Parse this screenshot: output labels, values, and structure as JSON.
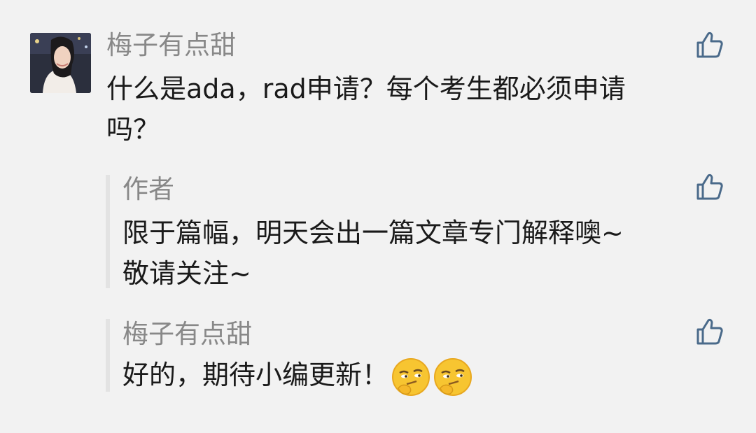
{
  "comment": {
    "author": "梅子有点甜",
    "text_line1": "什么是ada，rad申请？每个考生都必须申请",
    "text_line2": "吗？",
    "like_icon": "thumbs-up-outline-icon"
  },
  "replies": [
    {
      "author": "作者",
      "text_line1": "限于篇幅，明天会出一篇文章专门解释噢~",
      "text_line2": "敬请关注~",
      "like_icon": "thumbs-up-outline-icon"
    },
    {
      "author": "梅子有点甜",
      "text": "好的，期待小编更新！",
      "emojis": [
        "smirk-emoji",
        "smirk-emoji"
      ],
      "like_icon": "thumbs-up-outline-icon"
    }
  ],
  "colors": {
    "background": "#f2f2f2",
    "name": "#888888",
    "text": "#1a1a1a",
    "icon_blue": "#4a6a8a",
    "reply_bar": "#e3e3e3"
  }
}
